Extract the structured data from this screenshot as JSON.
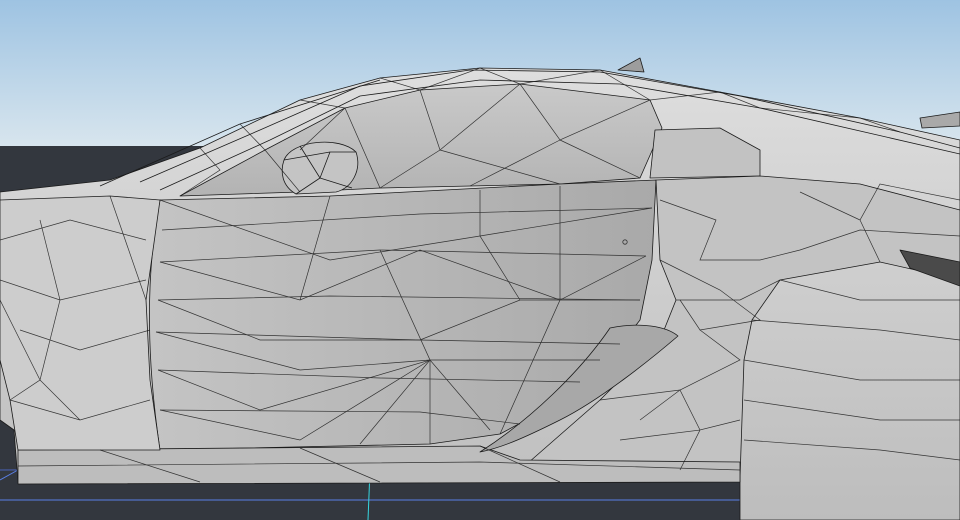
{
  "viewport": {
    "view": "side-wireframe",
    "colors": {
      "sky_top": "#9ec3e2",
      "sky_bottom": "#d9e6ee",
      "ground": "#33373e",
      "grid_line": "#5a7fe6",
      "grid_axis": "#36d6e0",
      "mesh_fill": "#cfcfcf",
      "mesh_shadow": "#9a9a9a",
      "wire": "#1b1b1b"
    }
  }
}
